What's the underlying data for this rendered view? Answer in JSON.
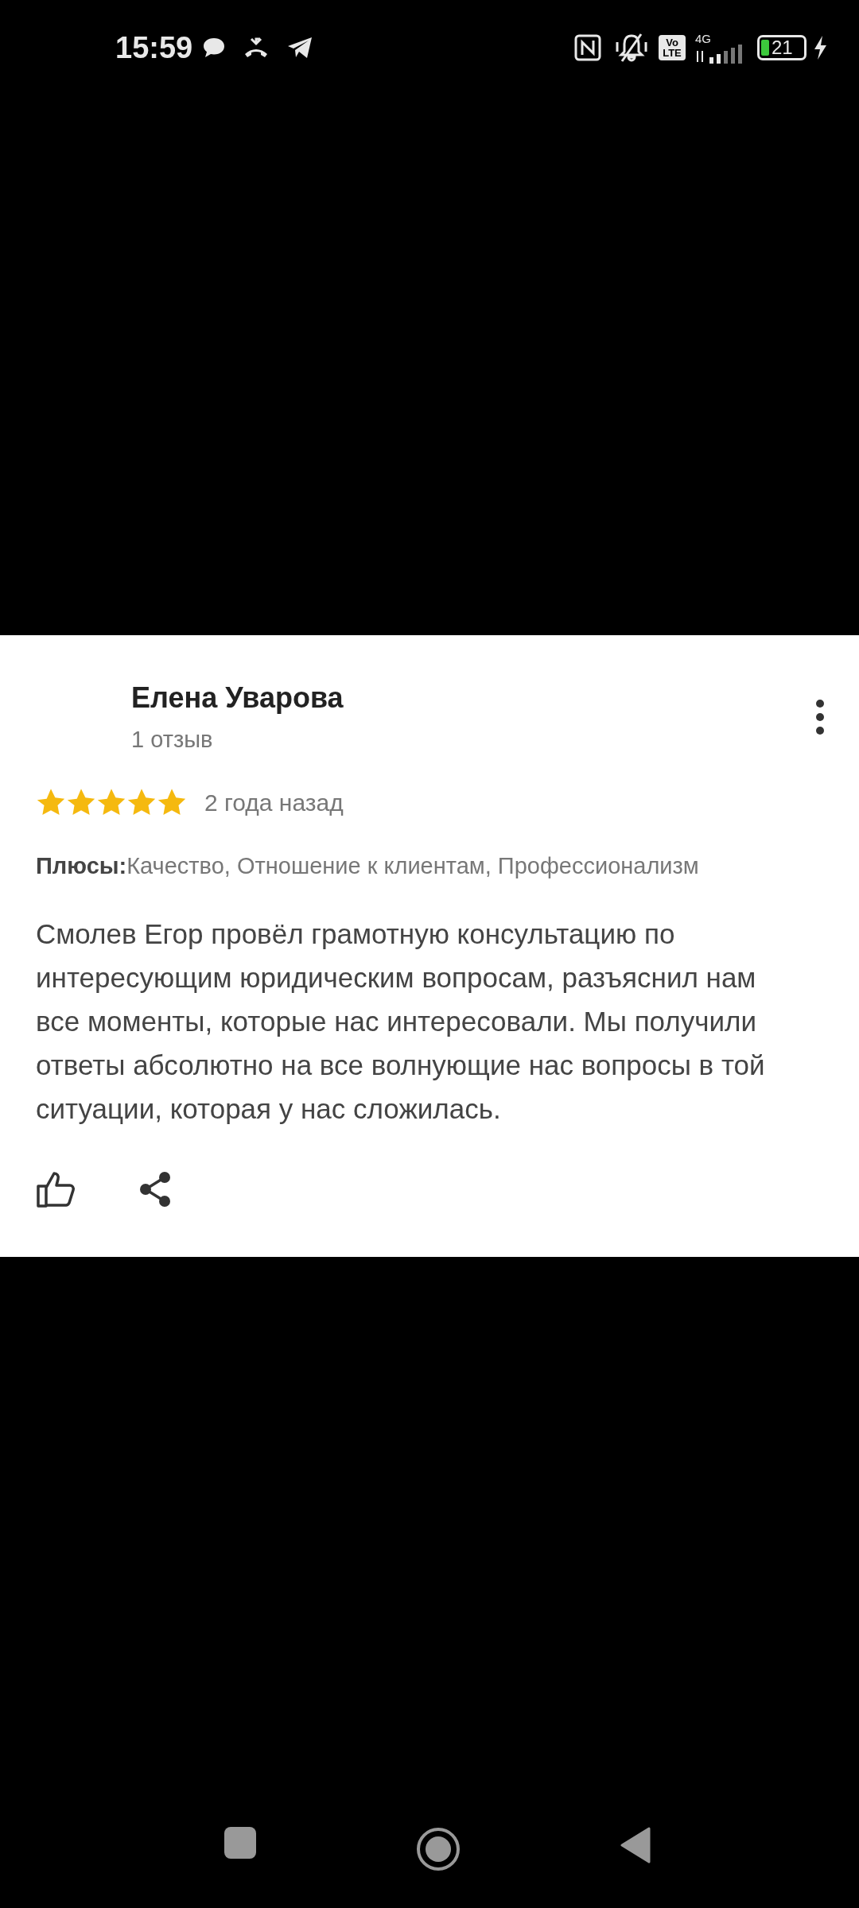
{
  "status_bar": {
    "time": "15:59",
    "network": "4G",
    "volte": [
      "Vo",
      "LTE"
    ],
    "battery": "21"
  },
  "review": {
    "author": "Елена Уварова",
    "author_reviews": "1 отзыв",
    "stars": 5,
    "date": "2 года назад",
    "pros_label": "Плюсы:",
    "pros": "Качество, Отношение к клиентам, Профессионализм",
    "text": "Смолев Егор провёл грамотную консультацию по интересующим юридическим вопросам, разъяснил нам все моменты, которые нас интересовали. Мы получили ответы абсолютно на все волнующие нас вопросы в той ситуации, которая у нас сложилась."
  }
}
